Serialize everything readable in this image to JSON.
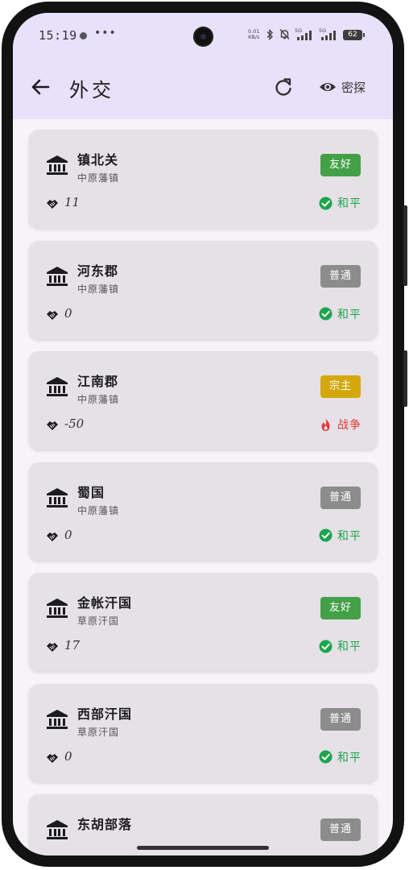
{
  "status_bar": {
    "time": "15:19",
    "more": "•••",
    "net_speed_value": "0.01",
    "net_speed_unit": "KB/s",
    "signal1_label": "5G",
    "signal2_label": "5G",
    "battery": "62"
  },
  "app_bar": {
    "title": "外交",
    "spy_label": "密探",
    "icons": {
      "back": "arrow-left-icon",
      "refresh": "refresh-icon",
      "spy": "eye-icon"
    }
  },
  "colors": {
    "app_bar_bg": "#e9e1fb",
    "card_bg": "#e5e1e6",
    "badge_friendly": "#43a047",
    "badge_normal": "#8c8c8c",
    "badge_suzerain": "#d4a80a",
    "peace": "#1aa64b",
    "war": "#e53935"
  },
  "cards": [
    {
      "name": "镇北关",
      "type": "中原藩镇",
      "badge": "友好",
      "badge_kind": "friendly",
      "relation": "11",
      "state": "和平",
      "state_kind": "peace"
    },
    {
      "name": "河东郡",
      "type": "中原藩镇",
      "badge": "普通",
      "badge_kind": "normal",
      "relation": "0",
      "state": "和平",
      "state_kind": "peace"
    },
    {
      "name": "江南郡",
      "type": "中原藩镇",
      "badge": "宗主",
      "badge_kind": "suzerain",
      "relation": "-50",
      "state": "战争",
      "state_kind": "war"
    },
    {
      "name": "蜀国",
      "type": "中原藩镇",
      "badge": "普通",
      "badge_kind": "normal",
      "relation": "0",
      "state": "和平",
      "state_kind": "peace"
    },
    {
      "name": "金帐汗国",
      "type": "草原汗国",
      "badge": "友好",
      "badge_kind": "friendly",
      "relation": "17",
      "state": "和平",
      "state_kind": "peace"
    },
    {
      "name": "西部汗国",
      "type": "草原汗国",
      "badge": "普通",
      "badge_kind": "normal",
      "relation": "0",
      "state": "和平",
      "state_kind": "peace"
    },
    {
      "name": "东胡部落",
      "type": "",
      "badge": "普通",
      "badge_kind": "normal",
      "relation": "",
      "state": "",
      "state_kind": ""
    }
  ]
}
